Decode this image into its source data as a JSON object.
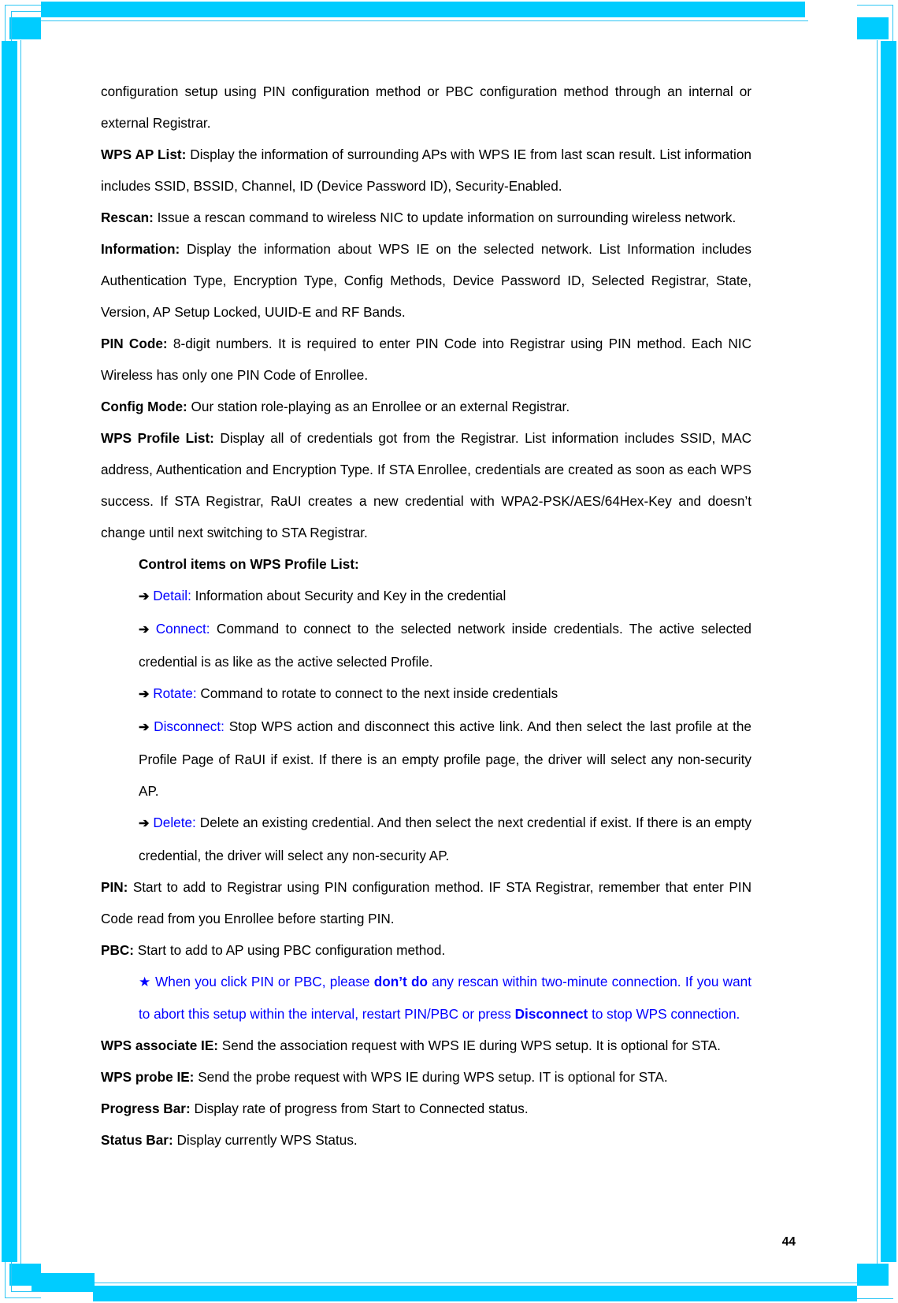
{
  "document": {
    "page_number": "44",
    "accent_color": "#00CCFF",
    "link_color": "#0000FF",
    "text_color": "#000000"
  },
  "body": {
    "p1": "configuration setup using PIN configuration method or PBC configuration method through an internal or external Registrar.",
    "p2_lead": "WPS AP List:",
    "p2_text": " Display the information of surrounding APs with WPS IE from last scan result. List information includes SSID, BSSID, Channel, ID (Device Password ID), Security-Enabled.",
    "p3_lead": "Rescan:",
    "p3_text": " Issue a rescan command to wireless NIC to update information on surrounding wireless network.",
    "p4_lead": "Information:",
    "p4_text": " Display the information about WPS IE on the selected network. List Information includes Authentication Type, Encryption Type, Config Methods, Device Password ID, Selected Registrar, State, Version, AP Setup Locked, UUID-E and RF Bands.",
    "p5_lead": "PIN Code:",
    "p5_text": " 8-digit numbers. It is required to enter PIN Code into Registrar using PIN method. Each NIC Wireless has only one PIN Code of Enrollee.",
    "p6_lead": "Config Mode:",
    "p6_text": " Our station role-playing as an Enrollee or an external Registrar.",
    "p7_lead": "WPS Profile List:",
    "p7_text": " Display all of credentials got from the Registrar. List information includes SSID, MAC address, Authentication and Encryption Type. If STA Enrollee, credentials are created as soon as each WPS success. If STA Registrar, RaUI creates a new credential with WPA2-PSK/AES/64Hex-Key and doesn’t change until next switching to STA Registrar.",
    "control_heading": "Control items on WPS Profile List:",
    "arrow_glyph": "➔",
    "star_glyph": "★",
    "items": [
      {
        "name": "Detail:",
        "text": " Information about Security and Key in the credential"
      },
      {
        "name": "Connect:",
        "text": " Command to connect to the selected network inside credentials. The active selected credential is as like as the active selected Profile."
      },
      {
        "name": "Rotate:",
        "text": " Command to rotate to connect to the next inside credentials"
      },
      {
        "name": "Disconnect:",
        "text": " Stop WPS action and disconnect this active link. And then select the last profile at the Profile Page of RaUI if exist. If there is an empty profile page, the driver will select any non-security AP."
      },
      {
        "name": "Delete:",
        "text": " Delete an existing credential. And then select the next credential if exist. If there is an empty credential, the driver will select any non-security AP."
      }
    ],
    "p8_lead": "PIN:",
    "p8_text": " Start to add to Registrar using PIN configuration method. IF STA Registrar, remember that enter PIN Code read from you Enrollee before starting PIN.",
    "p9_lead": "PBC:",
    "p9_text": " Start to add to AP using PBC configuration method.",
    "note_part1": "When you click PIN or PBC, please ",
    "note_bold1": "don’t do",
    "note_part2": " any rescan within two-minute connection. If you want to abort this setup within the interval, restart PIN/PBC or press ",
    "note_bold2": "Disconnect",
    "note_part3": " to stop WPS connection.",
    "p10_lead": "WPS associate IE:",
    "p10_text": " Send the association request with WPS IE during WPS setup. It is optional for STA.",
    "p11_lead": "WPS probe IE:",
    "p11_text": " Send the probe request with WPS IE during WPS setup. IT is optional for STA.",
    "p12_lead": "Progress Bar:",
    "p12_text": " Display rate of progress from Start to Connected status.",
    "p13_lead": "Status Bar:",
    "p13_text": " Display currently WPS Status."
  }
}
